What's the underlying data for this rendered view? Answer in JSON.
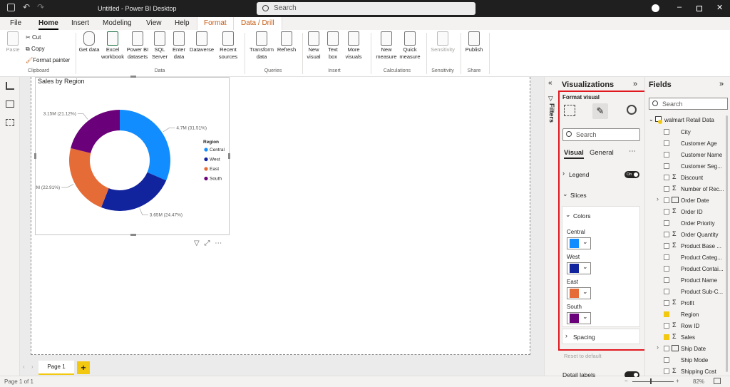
{
  "titlebar": {
    "title": "Untitled - Power BI Desktop",
    "search": "Search"
  },
  "menu": [
    "File",
    "Home",
    "Insert",
    "Modeling",
    "View",
    "Help",
    "Format",
    "Data / Drill"
  ],
  "ribbon": {
    "paste": "Paste",
    "cut": "Cut",
    "copy": "Copy",
    "format_painter": "Format painter",
    "get_data": "Get data",
    "excel": "Excel workbook",
    "pbi_datasets": "Power BI datasets",
    "sql": "SQL Server",
    "enter_data": "Enter data",
    "dataverse": "Dataverse",
    "recent": "Recent sources",
    "transform": "Transform data",
    "refresh": "Refresh",
    "new_visual": "New visual",
    "text_box": "Text box",
    "more_visuals": "More visuals",
    "new_measure": "New measure",
    "quick_measure": "Quick measure",
    "sensitivity": "Sensitivity",
    "publish": "Publish",
    "groups": {
      "clipboard": "Clipboard",
      "data": "Data",
      "queries": "Queries",
      "insert": "Insert",
      "calculations": "Calculations",
      "sensitivity": "Sensitivity",
      "share": "Share"
    }
  },
  "visual": {
    "title": "Sales by Region"
  },
  "chart_data": {
    "type": "donut",
    "title": "Sales by Region",
    "legend_title": "Region",
    "legend_position": "right",
    "categories": [
      "Central",
      "West",
      "East",
      "South"
    ],
    "values": [
      31.51,
      24.47,
      22.91,
      21.12
    ],
    "data_labels": [
      "4.7M (31.51%)",
      "3.65M (24.47%)",
      "3.42M (22.91%)",
      "3.15M (21.12%)"
    ],
    "colors": [
      "#118DFF",
      "#12239E",
      "#E66C37",
      "#6B007B"
    ]
  },
  "tabs": {
    "page1": "Page 1"
  },
  "status": {
    "page": "Page 1 of 1",
    "zoom": "82%"
  },
  "filters": {
    "label": "Filters"
  },
  "viz": {
    "title": "Visualizations",
    "format_visual": "Format visual",
    "search": "Search",
    "tab_visual": "Visual",
    "tab_general": "General",
    "legend": "Legend",
    "legend_toggle": "On",
    "slices": "Slices",
    "colors": "Colors",
    "color_items": [
      {
        "name": "Central",
        "color": "#118DFF"
      },
      {
        "name": "West",
        "color": "#12239E"
      },
      {
        "name": "East",
        "color": "#E66C37"
      },
      {
        "name": "South",
        "color": "#6B007B"
      }
    ],
    "spacing": "Spacing",
    "reset": "Reset to default",
    "detail_labels": "Detail labels"
  },
  "fields": {
    "title": "Fields",
    "search": "Search",
    "table": "walmart Retail Data",
    "items": [
      {
        "name": "City",
        "checked": false,
        "sigma": false
      },
      {
        "name": "Customer Age",
        "checked": false,
        "sigma": false
      },
      {
        "name": "Customer Name",
        "checked": false,
        "sigma": false
      },
      {
        "name": "Customer Seg...",
        "checked": false,
        "sigma": false
      },
      {
        "name": "Discount",
        "checked": false,
        "sigma": true
      },
      {
        "name": "Number of Rec...",
        "checked": false,
        "sigma": true
      },
      {
        "name": "Order Date",
        "checked": false,
        "sigma": false,
        "date": true
      },
      {
        "name": "Order ID",
        "checked": false,
        "sigma": true
      },
      {
        "name": "Order Priority",
        "checked": false,
        "sigma": false
      },
      {
        "name": "Order Quantity",
        "checked": false,
        "sigma": true
      },
      {
        "name": "Product Base ...",
        "checked": false,
        "sigma": true
      },
      {
        "name": "Product Categ...",
        "checked": false,
        "sigma": false
      },
      {
        "name": "Product Contai...",
        "checked": false,
        "sigma": false
      },
      {
        "name": "Product Name",
        "checked": false,
        "sigma": false
      },
      {
        "name": "Product Sub-C...",
        "checked": false,
        "sigma": false
      },
      {
        "name": "Profit",
        "checked": false,
        "sigma": true
      },
      {
        "name": "Region",
        "checked": true,
        "sigma": false
      },
      {
        "name": "Row ID",
        "checked": false,
        "sigma": true
      },
      {
        "name": "Sales",
        "checked": true,
        "sigma": true
      },
      {
        "name": "Ship Date",
        "checked": false,
        "sigma": false,
        "date": true
      },
      {
        "name": "Ship Mode",
        "checked": false,
        "sigma": false
      },
      {
        "name": "Shipping Cost",
        "checked": false,
        "sigma": true
      }
    ]
  }
}
